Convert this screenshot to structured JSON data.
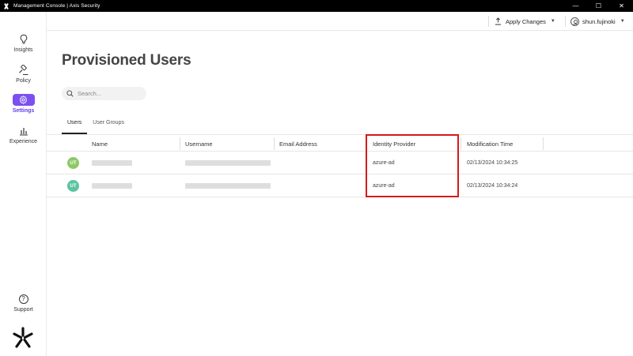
{
  "window": {
    "title": "Management Console | Axis Security",
    "minimize_glyph": "—",
    "maximize_glyph": "☐",
    "close_glyph": "✕"
  },
  "sidebar": {
    "items": [
      {
        "label": "Insights",
        "icon": "lightbulb-icon",
        "active": false
      },
      {
        "label": "Policy",
        "icon": "gavel-icon",
        "active": false
      },
      {
        "label": "Settings",
        "icon": "gear-icon",
        "active": true
      },
      {
        "label": "Experience",
        "icon": "bar-chart-icon",
        "active": false
      }
    ],
    "support": {
      "label": "Support",
      "icon": "question-circle-icon",
      "glyph": "?"
    },
    "logo": "axis-logo"
  },
  "header": {
    "apply_changes": {
      "label": "Apply Changes",
      "icon": "upload-icon",
      "chevron": "▼"
    },
    "user": {
      "name": "shun.fujinoki",
      "icon": "user-avatar-icon",
      "chevron": "▼"
    }
  },
  "page": {
    "title": "Provisioned Users",
    "search": {
      "placeholder": "Search...",
      "value": ""
    },
    "tabs": [
      {
        "label": "Users",
        "active": true
      },
      {
        "label": "User Groups",
        "active": false
      }
    ]
  },
  "table": {
    "columns": [
      "Name",
      "Username",
      "Email Address",
      "Identity Provider",
      "Modification Time"
    ],
    "rows": [
      {
        "initials": "UT",
        "avatar_color": "#8cc965",
        "name": "",
        "username": "",
        "email": "",
        "identity_provider": "azure-ad",
        "modification_time": "02/13/2024 10:34:25"
      },
      {
        "initials": "UT",
        "avatar_color": "#5cc3a0",
        "name": "",
        "username": "",
        "email": "",
        "identity_provider": "azure-ad",
        "modification_time": "02/13/2024 10:34:24"
      }
    ]
  },
  "colors": {
    "accent": "#7b4ff0",
    "highlight": "#d61a1a"
  }
}
